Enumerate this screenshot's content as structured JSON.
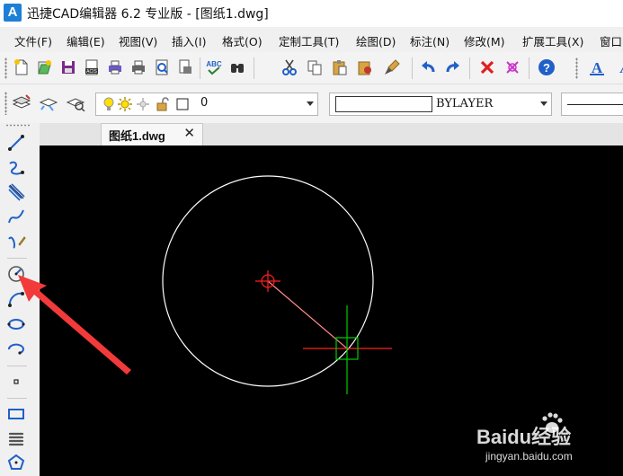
{
  "window": {
    "title": "迅捷CAD编辑器 6.2 专业版  - [图纸1.dwg]",
    "logo_letter": "A"
  },
  "menu": {
    "items": [
      "文件(F)",
      "编辑(E)",
      "视图(V)",
      "插入(I)",
      "格式(O)",
      "定制工具(T)",
      "绘图(D)",
      "标注(N)",
      "修改(M)",
      "扩展工具(X)",
      "窗口"
    ]
  },
  "layer_bar": {
    "current_layer": "0"
  },
  "properties_bar": {
    "color_value": "BYLAYER"
  },
  "tabs": [
    {
      "label": "图纸1.dwg",
      "close_glyph": "✕"
    }
  ],
  "colors": {
    "canvas_bg": "#000000",
    "circle": "#ffffff",
    "center_marker": "#ff2020",
    "radius_line": "#ff8a8a",
    "cursor_vertical": "#00cc00",
    "cursor_horizontal": "#ff2020",
    "annotation_arrow": "#f23a3a",
    "accent_blue": "#2060c8"
  },
  "icons": {
    "toolbar": [
      "new-icon",
      "open-icon",
      "save-icon",
      "acis-icon",
      "plot-icon",
      "print-icon",
      "print-preview-icon",
      "publish-icon",
      "spellcheck-icon",
      "find-icon",
      "cut-icon",
      "copy-icon",
      "paste-icon",
      "paste-special-icon",
      "match-properties-icon",
      "undo-icon",
      "redo-icon",
      "erase-icon",
      "purge-icon",
      "help-icon",
      "text-style-icon"
    ],
    "draw_tools": [
      "line-icon",
      "polyline-icon",
      "multiline-icon",
      "spline-icon",
      "freehand-icon",
      "arc-icon",
      "arc-3point-icon",
      "ellipse-icon",
      "ellipse-arc-icon",
      "point-icon",
      "rectangle-icon",
      "helix-icon",
      "polygon-icon"
    ]
  },
  "watermark": {
    "brand": "Baidu经验",
    "url": "jingyan.baidu.com"
  }
}
